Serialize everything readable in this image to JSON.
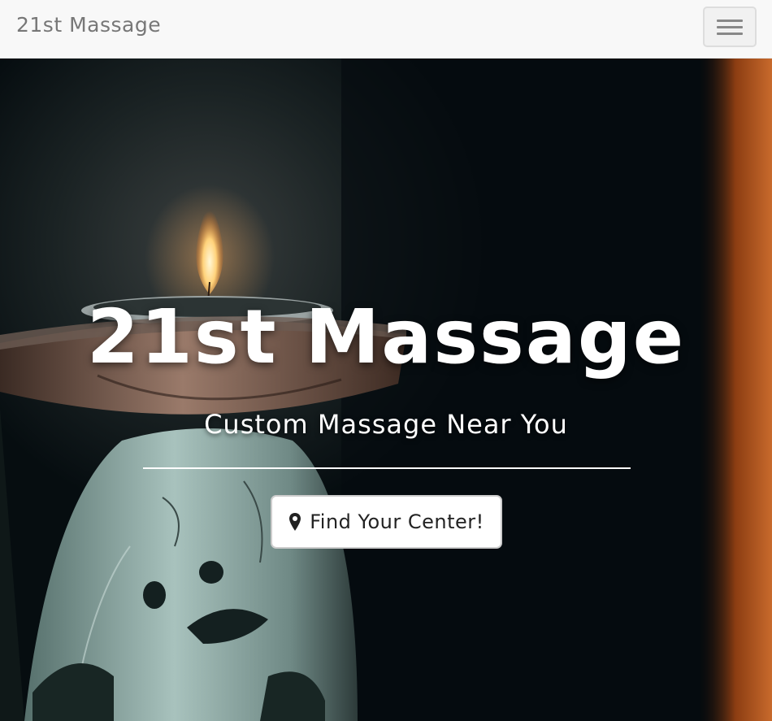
{
  "navbar": {
    "brand": "21st Massage",
    "menu_icon": "hamburger-menu-icon"
  },
  "hero": {
    "title": "21st Massage",
    "subtitle": "Custom Massage Near You",
    "cta_label": "Find Your Center!",
    "cta_icon": "map-marker-icon",
    "background": "candle-oil-burner-photo"
  },
  "colors": {
    "navbar_bg": "#f8f8f8",
    "brand_text": "#777777",
    "hero_text": "#ffffff",
    "button_bg": "#ffffff",
    "button_text": "#222222"
  }
}
